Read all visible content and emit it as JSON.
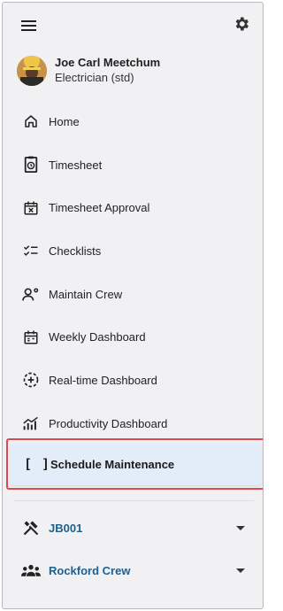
{
  "user": {
    "name": "Joe Carl Meetchum",
    "role": "Electrician (std)"
  },
  "nav": {
    "items": [
      {
        "label": "Home",
        "icon": "home-icon"
      },
      {
        "label": "Timesheet",
        "icon": "timesheet-icon"
      },
      {
        "label": "Timesheet Approval",
        "icon": "calendar-x-icon"
      },
      {
        "label": "Checklists",
        "icon": "checklist-icon"
      },
      {
        "label": "Maintain Crew",
        "icon": "crew-manage-icon"
      },
      {
        "label": "Weekly Dashboard",
        "icon": "calendar-icon"
      },
      {
        "label": "Real-time Dashboard",
        "icon": "refresh-plus-icon"
      },
      {
        "label": "Productivity Dashboard",
        "icon": "chart-icon"
      }
    ],
    "active": {
      "label": "Schedule Maintenance",
      "icon_text": "[ ]"
    }
  },
  "groups": {
    "job": {
      "label": "JB001",
      "icon": "tools-icon"
    },
    "crew": {
      "label": "Rockford Crew",
      "icon": "group-icon"
    }
  },
  "colors": {
    "accent": "#1f5f8f",
    "highlight_border": "#e0474e",
    "active_bg": "#e3ecf9"
  }
}
